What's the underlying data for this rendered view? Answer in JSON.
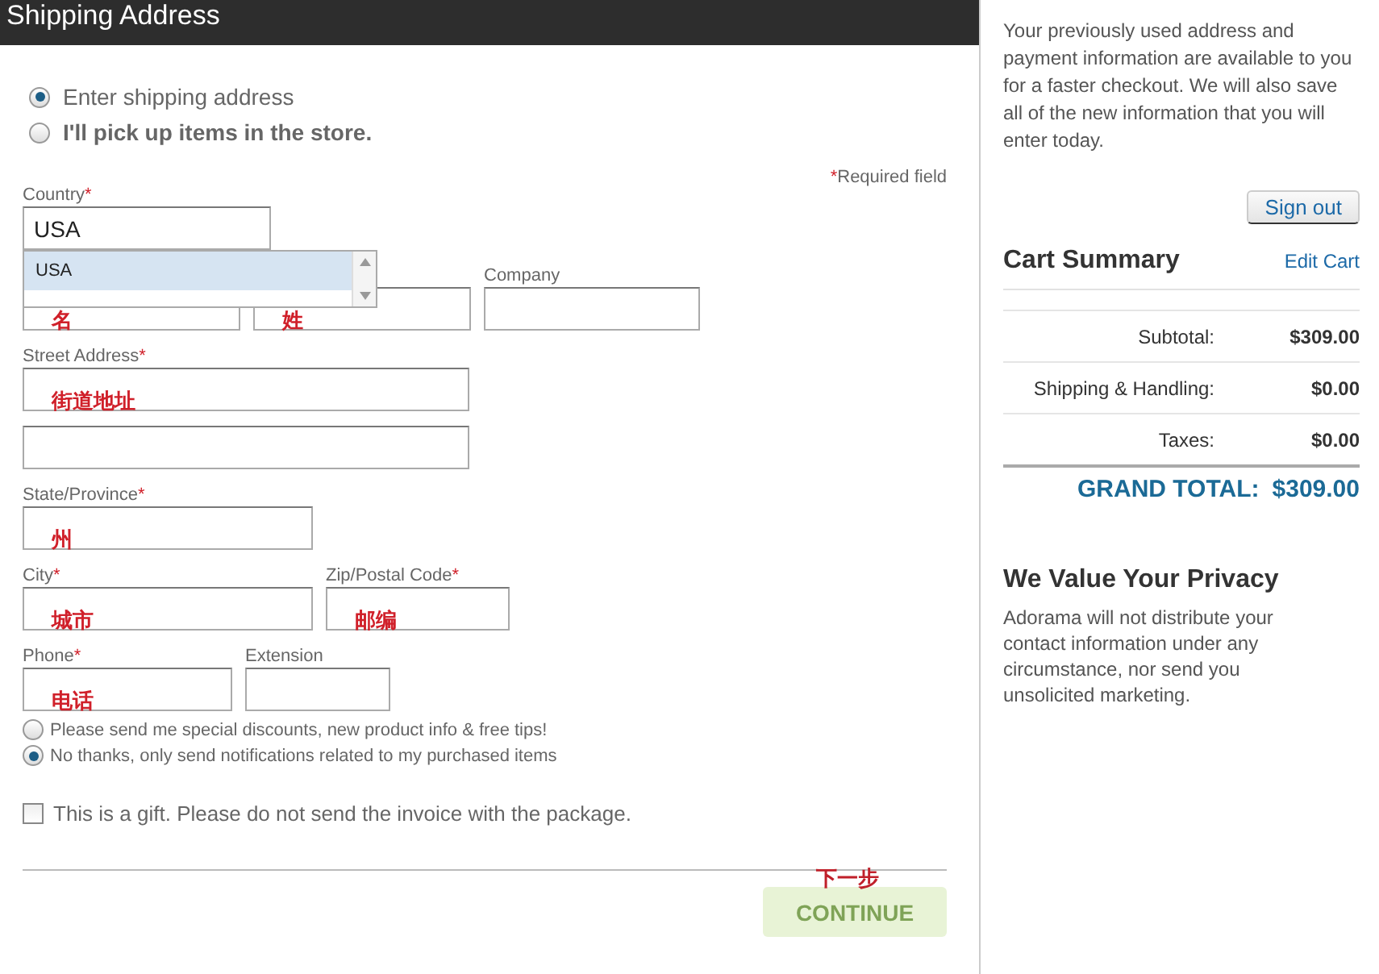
{
  "header": {
    "title": "Shipping Address"
  },
  "delivery_options": [
    {
      "label": "Enter shipping address",
      "selected": true,
      "kind": "plain"
    },
    {
      "label": "I'll pick up items in the store.",
      "selected": false,
      "kind": "bold"
    }
  ],
  "required_note": {
    "mark": "*",
    "text": "Required field"
  },
  "form_rows": [
    [
      {
        "label": "Country",
        "required_mark": "*",
        "value": "USA"
      }
    ],
    [
      {
        "annotation": "名"
      },
      {
        "annotation": "姓"
      },
      {
        "label": "Company"
      }
    ],
    [
      {
        "label": "Street Address",
        "required_mark": "*",
        "annotation": "街道地址"
      }
    ],
    [
      {}
    ],
    [
      {
        "label": "State/Province",
        "required_mark": "*",
        "annotation": "州"
      }
    ],
    [
      {
        "label": "City",
        "required_mark": "*",
        "annotation": "城市"
      },
      {
        "label": "Zip/Postal Code",
        "required_mark": "*",
        "annotation": "邮编"
      }
    ],
    [
      {
        "label": "Phone",
        "required_mark": "*",
        "annotation": "电话"
      },
      {
        "label": "Extension"
      }
    ]
  ],
  "country_dropdown": {
    "options": [
      {
        "label": "USA",
        "selected": true
      }
    ]
  },
  "newsletter_options": [
    {
      "label": "Please send me special discounts, new product info & free tips!",
      "selected": false
    },
    {
      "label": "No thanks, only send notifications related to my purchased items",
      "selected": true
    }
  ],
  "gift": {
    "label": "This is a gift. Please do not send the invoice with the package.",
    "checked": false
  },
  "continue": {
    "annotation": "下一步",
    "label": "CONTINUE",
    "disabled": true
  },
  "sidebar": {
    "intro": "Your previously used address and payment information are available to you for a faster checkout. We will also save all of the new information that you will enter today.",
    "sign_out": "Sign out",
    "cart_title": "Cart Summary",
    "edit_cart": "Edit Cart",
    "summary_rows": [
      {
        "label": "Subtotal:",
        "value": "$309.00"
      },
      {
        "label": "Shipping & Handling:",
        "value": "$0.00"
      },
      {
        "label": "Taxes:",
        "value": "$0.00"
      }
    ],
    "grand_total": {
      "label": "GRAND TOTAL:",
      "value": "$309.00"
    },
    "privacy_title": "We Value Your Privacy",
    "privacy_text": "Adorama will not distribute your contact information under any circumstance, nor send you unsolicited marketing."
  }
}
